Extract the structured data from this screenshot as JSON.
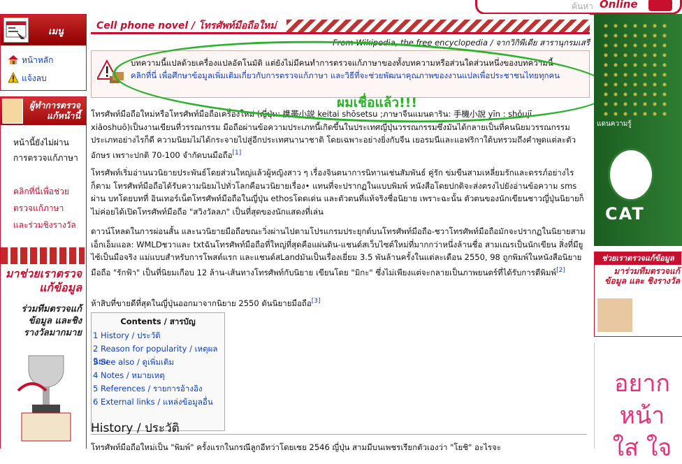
{
  "topbar": {
    "search_hint": "ค้นหา",
    "brand_word": "Online"
  },
  "sidebar": {
    "menu_title": "เมนู",
    "items": [
      {
        "label": "หน้าหลัก",
        "icon": "home-icon"
      },
      {
        "label": "แจ้งลบ",
        "icon": "warning-icon"
      }
    ],
    "promo_title": "ผู้ทำการตรวจแก้หน้านี้",
    "promo_lines": [
      "หน้านี้ยังไม่ผ่าน",
      "การตรวจแก้ภาษา"
    ],
    "promo_links": [
      "คลิกที่นี่เพื่อช่วย",
      "ตรวจแก้ภาษา",
      "และร่วมชิงรางวัล"
    ],
    "banner_title": "มาช่วยเราตรวจแก้ข้อมูล",
    "banner_sub": "ร่วมทีมตรวจแก้ข้อมูล และชิงรางวัลมากมาย"
  },
  "article": {
    "title": "Cell phone novel / โทรศัพท์มือถือใหม่",
    "from": "From Wikipedia, the free encyclopedia / จากวิกิพีเดีย สารานุกรมเสรี",
    "notice_line1": "บทความนี้แปลด้วยเครื่องแปลอัตโนมัติ แต่ยังไม่มีคนทำการตรวจแก้ภาษาของทั้งบทความหรือส่วนใดส่วนหนึ่งของบทความนี้",
    "notice_line2": "คลิกที่นี่ เพื่อศึกษาข้อมูลเพิ่มเติมเกี่ยวกับการตรวจแก้ภาษา และวิธีที่จะช่วยพัฒนาคุณภาพของงานแปลเพื่อประชาชนไทยทุกคน",
    "annotation": "ผมเชื่อแล้ว!!!",
    "p1": "โทรศัพท์มือถือใหม่หรือโทรศัพท์มือถือเครื่องใหม่ (ญี่ปุ่น: 携帯小説 keitai shōsetsu ;ภาษาจีนแมนดาริน: 手機小說 yīn : shǒujī xiǎoshuō)เป็นงานเขียนที่วรรณกรรม มือถือผ่านข้อความประเภทนี้เกิดขึ้นในประเทศญี่ปุ่นวรรณกรรมซึ่งมันได้กลายเป็นที่คนนิยมวรรณกรรมประเภทอย่างไรก็ดี ความนิยมไม่ได้กระจายไปสู่อีกประเทศนานาชาติ โดยเฉพาะอย่างยิ่งกับจีน เยอรมนีและแอฟริกาใต้บทรวมถึงคำพูดแต่ละตัวอักษร เพราะปกติ 70-100 จำกัดบนมือถือ",
    "p1_ref": "[1]",
    "p2": "โทรศัพท์เริ่มอ่านนวนิยายประพันธ์โดยส่วนใหญ่แล้วผู้หญิงสาว ๆ เรื่องจินตนาการนิทานเช่นสัมพันธ์ คู่รัก ข่มขืนสามเหลี่ยมรักและดรรภ์อย่างไรก็ตาม โทรศัพท์มือถือได้รับความนิยมไปทั่วโลกคือนวนิยายเรื่อง• แทนที่จะปรากฏในแบบพิมพ์ หนังสือโดยปกติจะส่งตรงไปยังอ่านข้อความ sms ผ่าน บทโดยบทที่ อินเทอร์เน็ตโทรศัพท์มือถือในญี่ปุ่น ethosโดดเด่น และตัวตนที่แท้จริงชื่อนิยาย เพราะฉะนั้น ตัวตนของนักเขียนชาวญี่ปุ่นนิยายก็ไม่ค่อยได้เปิดโทรศัพท์มือถือ \"สวิงวัลลภ\" เป็นที่สุดของนักแสดงที่เล่น",
    "p3": "ดาวน์โหลดในการผ่อนสั้น และนวนิยายมือถือขณะวิ่งผ่านไปตามโปรแกรมประยุกต์บนโทรศัพท์มือถือ-ชวาโทรศัพท์มือถือมักจะปรากฏในนิยายสามเอ็กเอ็มแอล: WMLDชวาและ txtฉันโทรศัพท์มือถือที่ใหญ่ที่สุดคือแผ่นดิน-แชนด์สเว็บไซต์ใหม่ที่มากกว่าหนึ่งล้านชื่อ สามเณรเป็นนักเขียน สิ่งที่มียูไซ้เป็นมือจริง แม่แบบสำหรับการโพสต์แรก และแชนด์สLandมันเป็นเรื่องเยี่ยม 3.5 พันล้านครั้งในแต่ละเดือน 2550, 98 ถูกพิมพ์ในหนังสือนิยายมือถือ \"รักฟ้า\" เป็นที่นิยมเกือบ 12 ล้าน-เส้นทางโทรศัพท์กับนิยาย เขียนโดย \"มิกะ\" ซึ่งไม่เพียงแต่จะกลายเป็นภาพยนตร์ที่ได้รับการตีพิมพ์",
    "p3_ref": "[2]",
    "p4": "ห้าสิบที่ขายดีที่สุดในญี่ปุ่นออกมาจากนิยาย 2550 ดันนิยายมือถือ",
    "p4_ref": "[3]",
    "toc_title": "Contents / สารบัญ",
    "toc": [
      "1 History / ประวัติ",
      "2 Reason for popularity / เหตุผลนิยม",
      "3 See also / ดูเพิ่มเติม",
      "4 Notes / หมายเหตุ",
      "5 References / รายการอ้างอิง",
      "6 External links / แหล่งข้อมูลอื่น"
    ],
    "h2": "History / ประวัติ",
    "last_line": "โทรศัพท์มือถือใหม่เป็น \"พิมพ์\" ครั้งแรกในกรณีลูกอีทว่าโดยเซย 2546 ญี่ปุ่น สามมีบนเพชรเรียกตัวเองว่า \"โยชิ\" อะไรจะ"
  },
  "right_ads": {
    "ad1_label": "แดนความรู้",
    "ad1_brand": "CAT",
    "ad2_head": "ช่วยเราตรวจแก้ข้อมูล",
    "ad2_body": "มาร่วมทีมตรวจแก้ข้อมูล และ ชิงรางวัล",
    "ad3_text": "อยาก หน้าใส ใจ"
  },
  "colors": {
    "brand_red": "#c8102e",
    "link_blue": "#0b3fc8",
    "annotation_green": "#2ab32a"
  }
}
